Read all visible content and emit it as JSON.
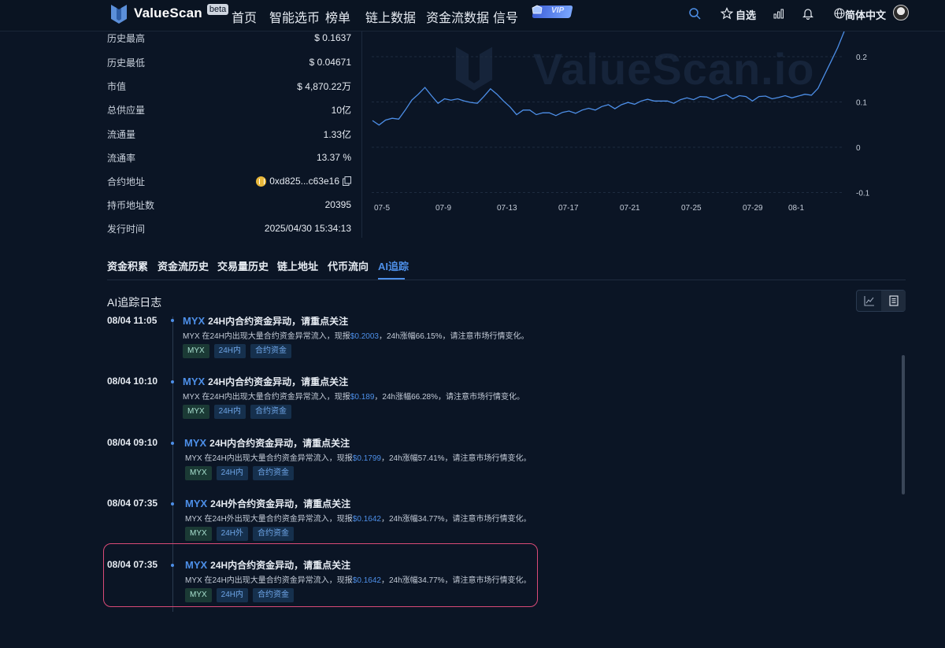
{
  "header": {
    "brand": "ValueScan",
    "beta": "beta",
    "nav": [
      "首页",
      "智能选币",
      "榜单",
      "链上数据",
      "资金流数据",
      "信号"
    ],
    "vip": "VIP",
    "watchlist": "自选",
    "language": "简体中文"
  },
  "info": [
    {
      "label": "历史最高",
      "value": "$ 0.1637"
    },
    {
      "label": "历史最低",
      "value": "$ 0.04671"
    },
    {
      "label": "市值",
      "value": "$ 4,870.22万"
    },
    {
      "label": "总供应量",
      "value": "10亿"
    },
    {
      "label": "流通量",
      "value": "1.33亿"
    },
    {
      "label": "流通率",
      "value": "13.37 %"
    },
    {
      "label": "合约地址",
      "value": "0xd825...c63e16"
    },
    {
      "label": "持币地址数",
      "value": "20395"
    },
    {
      "label": "发行时间",
      "value": "2025/04/30 15:34:13"
    }
  ],
  "chart": {
    "watermark": "ValueScan.io",
    "x_ticks": [
      "07-5",
      "07-9",
      "07-13",
      "07-17",
      "07-21",
      "07-25",
      "07-29",
      "08-1"
    ],
    "y_ticks": [
      "0.2",
      "0.1",
      "0",
      "-0.1"
    ]
  },
  "chart_data": {
    "type": "line",
    "x_ticks": [
      "07-5",
      "07-9",
      "07-13",
      "07-17",
      "07-21",
      "07-25",
      "07-29",
      "08-1"
    ],
    "ylim": [
      -0.1,
      0.25
    ],
    "series": [
      {
        "values": [
          0.055,
          0.052,
          0.058,
          0.06,
          0.065,
          0.08,
          0.1,
          0.12,
          0.13,
          0.11,
          0.1,
          0.105,
          0.1,
          0.11,
          0.1,
          0.095,
          0.1,
          0.11,
          0.125,
          0.12,
          0.1,
          0.085,
          0.075,
          0.08,
          0.078,
          0.075,
          0.074,
          0.072,
          0.073,
          0.075,
          0.076,
          0.078,
          0.08,
          0.082,
          0.085,
          0.088,
          0.09,
          0.088,
          0.092,
          0.095,
          0.098,
          0.1,
          0.102,
          0.105,
          0.1,
          0.098,
          0.1,
          0.103,
          0.105,
          0.108,
          0.11,
          0.107,
          0.108,
          0.11,
          0.112,
          0.11,
          0.112,
          0.108,
          0.105,
          0.11,
          0.109,
          0.11,
          0.108,
          0.11,
          0.112,
          0.111,
          0.113,
          0.118,
          0.13,
          0.16,
          0.19,
          0.22,
          0.26
        ]
      }
    ]
  },
  "tabs": [
    "资金积累",
    "资金流历史",
    "交易量历史",
    "链上地址",
    "代币流向",
    "AI追踪"
  ],
  "section_title": "AI追踪日志",
  "logs": [
    {
      "time": "08/04 11:05",
      "symbol": "MYX",
      "title": "24H内合约资金异动，请重点关注",
      "desc_prefix": "MYX 在24H内出现大量合约资金异常流入，现报",
      "price": "$0.2003",
      "desc_suffix": "，24h涨幅66.15%，请注意市场行情变化。",
      "tags": [
        "MYX",
        "24H内",
        "合约资金"
      ]
    },
    {
      "time": "08/04 10:10",
      "symbol": "MYX",
      "title": "24H内合约资金异动，请重点关注",
      "desc_prefix": "MYX 在24H内出现大量合约资金异常流入，现报",
      "price": "$0.189",
      "desc_suffix": "，24h涨幅66.28%，请注意市场行情变化。",
      "tags": [
        "MYX",
        "24H内",
        "合约资金"
      ]
    },
    {
      "time": "08/04 09:10",
      "symbol": "MYX",
      "title": "24H内合约资金异动，请重点关注",
      "desc_prefix": "MYX 在24H内出现大量合约资金异常流入，现报",
      "price": "$0.1799",
      "desc_suffix": "，24h涨幅57.41%，请注意市场行情变化。",
      "tags": [
        "MYX",
        "24H内",
        "合约资金"
      ]
    },
    {
      "time": "08/04 07:35",
      "symbol": "MYX",
      "title": "24H外合约资金异动，请重点关注",
      "desc_prefix": "MYX 在24H外出现大量合约资金异常流入，现报",
      "price": "$0.1642",
      "desc_suffix": "，24h涨幅34.77%，请注意市场行情变化。",
      "tags": [
        "MYX",
        "24H外",
        "合约资金"
      ]
    },
    {
      "time": "08/04 07:35",
      "symbol": "MYX",
      "title": "24H内合约资金异动，请重点关注",
      "desc_prefix": "MYX 在24H内出现大量合约资金异常流入，现报",
      "price": "$0.1642",
      "desc_suffix": "，24h涨幅34.77%，请注意市场行情变化。",
      "tags": [
        "MYX",
        "24H内",
        "合约资金"
      ]
    }
  ],
  "colors": {
    "accent": "#4d8fe8",
    "highlight": "#d94a77",
    "background": "#0b1525"
  }
}
